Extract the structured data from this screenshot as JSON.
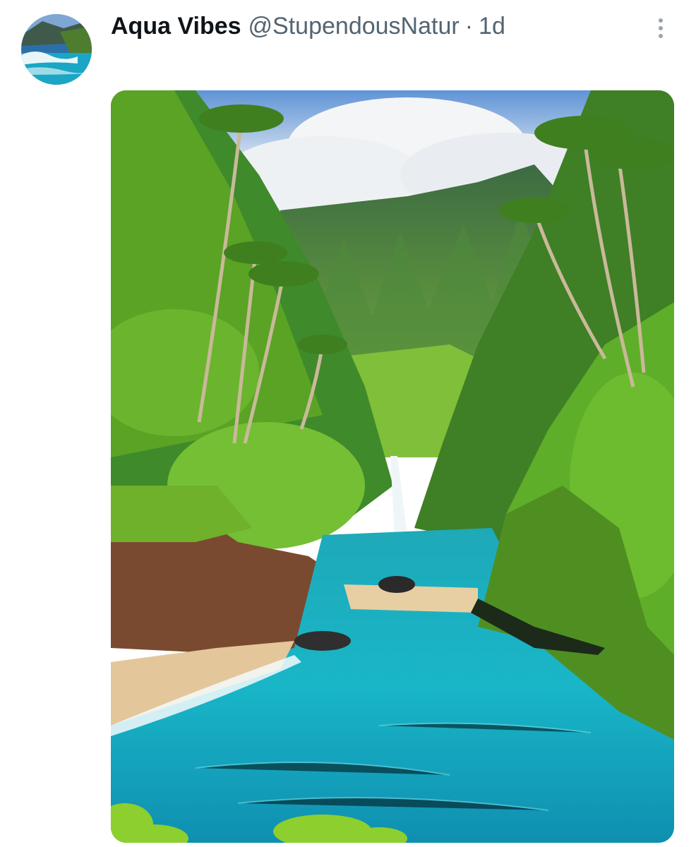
{
  "post": {
    "author": {
      "display_name": "Aqua Vibes",
      "handle": "@StupendousNatur",
      "avatar_icon": "ocean-waves-avatar"
    },
    "separator": "·",
    "timestamp": "1d",
    "more_icon": "more-vertical-icon",
    "media": {
      "kind": "photo",
      "subject_icon": "tropical-cove-photo"
    }
  },
  "colors": {
    "name_text": "#0f1419",
    "secondary_text": "#536471",
    "lagoon": "#1fb3c2",
    "foliage": "#5aa324"
  }
}
